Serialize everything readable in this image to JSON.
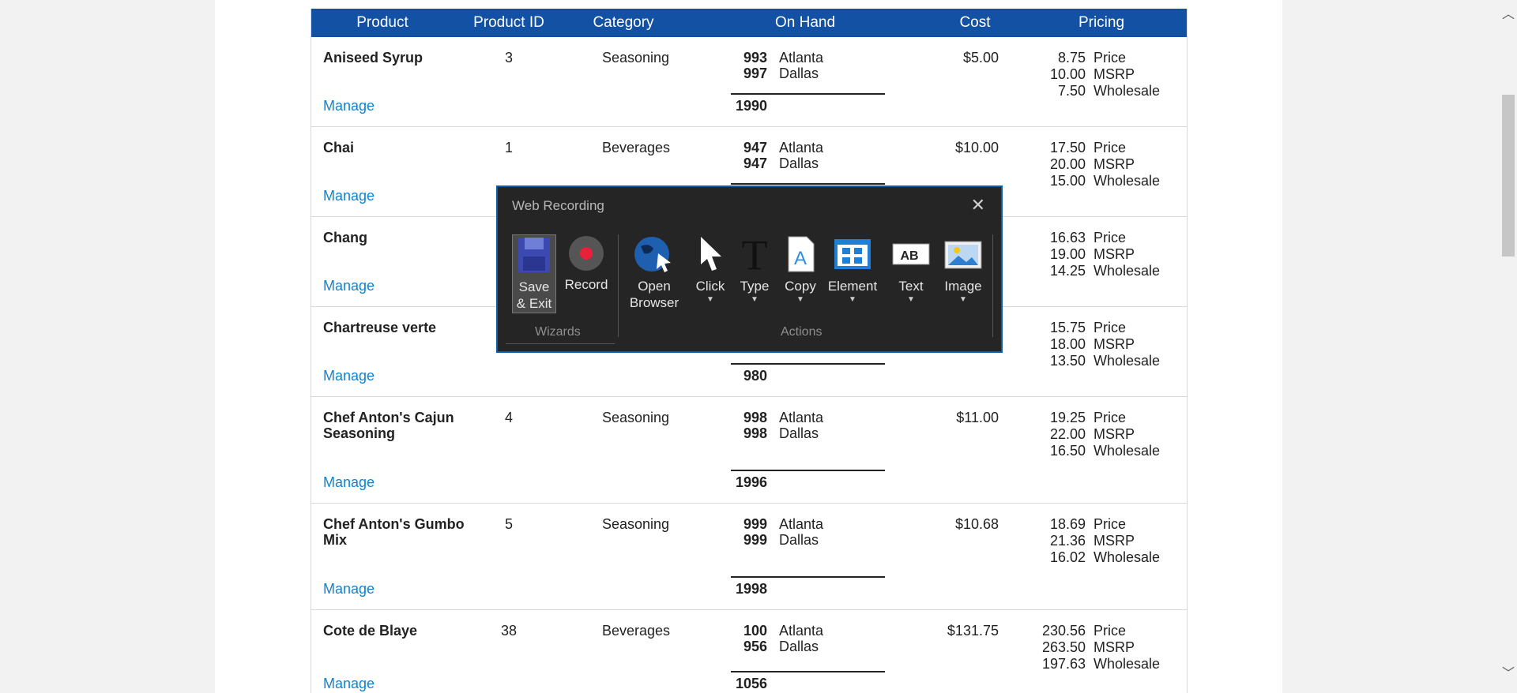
{
  "table": {
    "headers": [
      "Product",
      "Product ID",
      "Category",
      "On Hand",
      "Cost",
      "Pricing"
    ],
    "manage_label": "Manage",
    "price_labels": [
      "Price",
      "MSRP",
      "Wholesale"
    ],
    "rows": [
      {
        "name": "Aniseed Syrup",
        "name2": "",
        "id": "3",
        "category": "Seasoning",
        "qty": [
          "993",
          "997"
        ],
        "locs": [
          "Atlanta",
          "Dallas"
        ],
        "total": "1990",
        "cost": "$5.00",
        "prices": [
          "8.75",
          "10.00",
          "7.50"
        ]
      },
      {
        "name": "Chai",
        "name2": "",
        "id": "1",
        "category": "Beverages",
        "qty": [
          "947",
          "947"
        ],
        "locs": [
          "Atlanta",
          "Dallas"
        ],
        "total": "",
        "cost": "$10.00",
        "prices": [
          "17.50",
          "20.00",
          "15.00"
        ]
      },
      {
        "name": "Chang",
        "name2": "",
        "id": "",
        "category": "",
        "qty": [
          "",
          ""
        ],
        "locs": [
          "",
          ""
        ],
        "total": "",
        "cost": "",
        "prices": [
          "16.63",
          "19.00",
          "14.25"
        ]
      },
      {
        "name": "Chartreuse verte",
        "name2": "",
        "id": "",
        "category": "",
        "qty": [
          "",
          ""
        ],
        "locs": [
          "",
          ""
        ],
        "total": "980",
        "cost": "",
        "prices": [
          "15.75",
          "18.00",
          "13.50"
        ]
      },
      {
        "name": "Chef Anton's Cajun",
        "name2": "Seasoning",
        "id": "4",
        "category": "Seasoning",
        "qty": [
          "998",
          "998"
        ],
        "locs": [
          "Atlanta",
          "Dallas"
        ],
        "total": "1996",
        "cost": "$11.00",
        "prices": [
          "19.25",
          "22.00",
          "16.50"
        ]
      },
      {
        "name": "Chef Anton's Gumbo",
        "name2": "Mix",
        "id": "5",
        "category": "Seasoning",
        "qty": [
          "999",
          "999"
        ],
        "locs": [
          "Atlanta",
          "Dallas"
        ],
        "total": "1998",
        "cost": "$10.68",
        "prices": [
          "18.69",
          "21.36",
          "16.02"
        ]
      },
      {
        "name": "Cote de Blaye",
        "name2": "",
        "id": "38",
        "category": "Beverages",
        "qty": [
          "100",
          "956"
        ],
        "locs": [
          "Atlanta",
          "Dallas"
        ],
        "total": "1056",
        "cost": "$131.75",
        "prices": [
          "230.56",
          "263.50",
          "197.63"
        ]
      }
    ]
  },
  "dialog": {
    "title": "Web Recording",
    "wizards_label": "Wizards",
    "actions_label": "Actions",
    "tools": {
      "save": [
        "Save",
        "& Exit"
      ],
      "record": "Record",
      "open_browser": [
        "Open",
        "Browser"
      ],
      "click": "Click",
      "type": "Type",
      "copy": "Copy",
      "element": "Element",
      "text": "Text",
      "image": "Image"
    }
  },
  "colors": {
    "header_bg": "#1251a3",
    "link": "#0a84d8",
    "dialog_bg": "#252525",
    "record_red": "#e8203a"
  }
}
